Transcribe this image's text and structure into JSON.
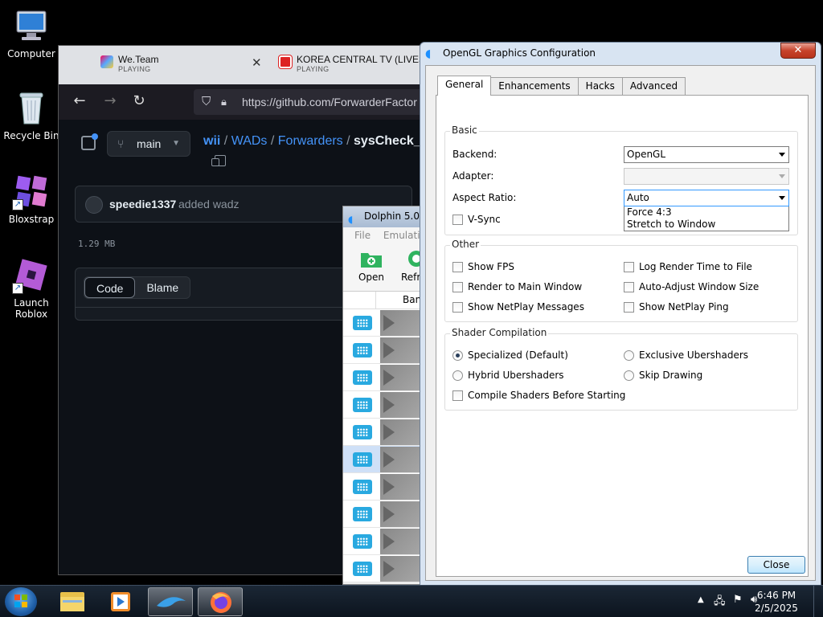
{
  "desktop": {
    "icons": [
      {
        "label": "Computer"
      },
      {
        "label": "Recycle Bin"
      },
      {
        "label": "Bloxstrap"
      },
      {
        "label": "Launch\nRoblox"
      }
    ]
  },
  "browser": {
    "tabs": [
      {
        "title": "We.Team",
        "status": "PLAYING"
      },
      {
        "title": "KOREA CENTRAL TV (LIVESTR",
        "status": "PLAYING"
      }
    ],
    "url": "https://github.com/ForwarderFactor",
    "github": {
      "branch": "main",
      "breadcrumb": [
        "wii",
        "WADs",
        "Forwarders",
        "sysCheck_De"
      ],
      "commit_author": "speedie1337",
      "commit_message": "added wadz",
      "file_size": "1.29 MB",
      "view_tabs": [
        "Code",
        "Blame"
      ]
    }
  },
  "dolphin": {
    "title": "Dolphin 5.0-",
    "menu": [
      "File",
      "Emulatio"
    ],
    "toolbar": [
      "Open",
      "Refr"
    ],
    "column_header": "Ban",
    "row_count": 10
  },
  "dialog": {
    "title": "OpenGL Graphics Configuration",
    "tabs": [
      "General",
      "Enhancements",
      "Hacks",
      "Advanced"
    ],
    "active_tab": "General",
    "basic": {
      "group_label": "Basic",
      "backend_label": "Backend:",
      "backend_value": "OpenGL",
      "adapter_label": "Adapter:",
      "adapter_value": "",
      "aspect_label": "Aspect Ratio:",
      "aspect_value": "Auto",
      "aspect_options": [
        "Force 4:3",
        "Stretch to Window"
      ],
      "vsync_label": "V-Sync"
    },
    "other": {
      "group_label": "Other",
      "left": [
        "Show FPS",
        "Render to Main Window",
        "Show NetPlay Messages"
      ],
      "right": [
        "Log Render Time to File",
        "Auto-Adjust Window Size",
        "Show NetPlay Ping"
      ]
    },
    "shader": {
      "group_label": "Shader Compilation",
      "specialized": "Specialized (Default)",
      "exclusive": "Exclusive Ubershaders",
      "hybrid": "Hybrid Ubershaders",
      "skip": "Skip Drawing",
      "compile_before": "Compile Shaders Before Starting",
      "selected": "Specialized (Default)"
    },
    "close_label": "Close"
  },
  "taskbar": {
    "time": "6:46 PM",
    "date": "2/5/2025"
  }
}
